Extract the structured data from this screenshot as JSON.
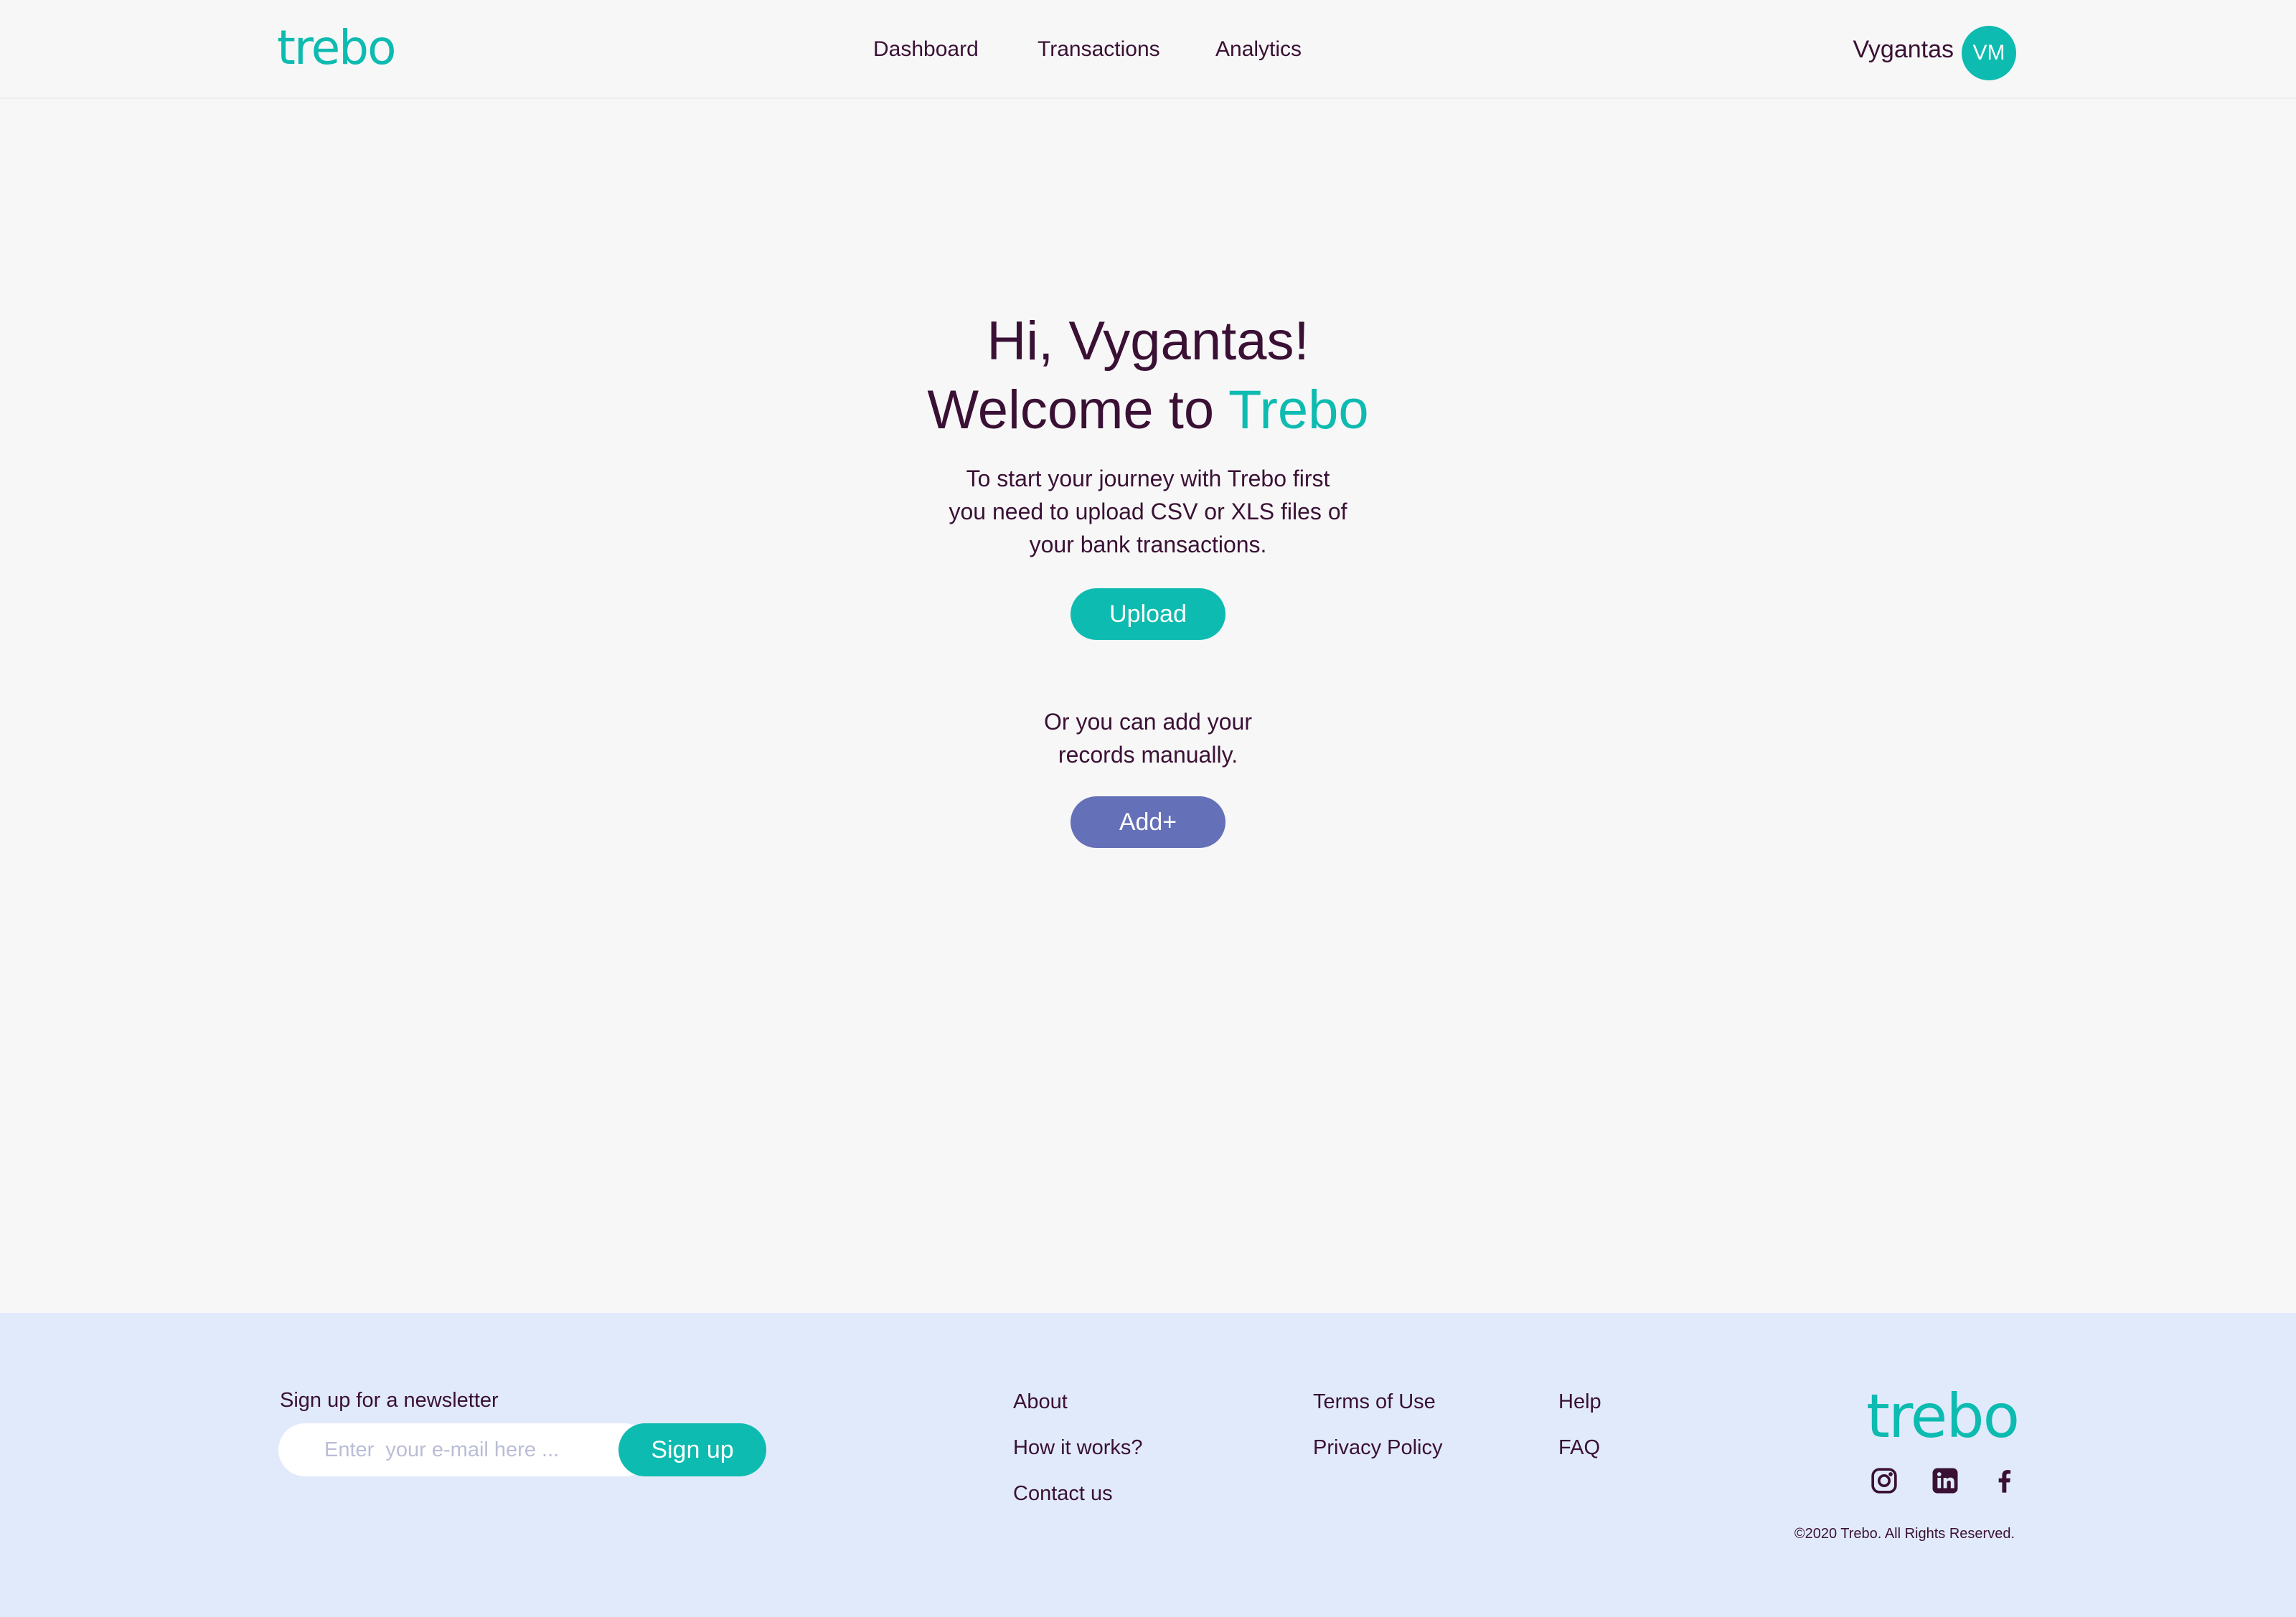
{
  "brand": {
    "logo_text": "trebo",
    "accent_color": "#0dbbb0",
    "secondary_color": "#6470b7",
    "text_color": "#3a1135"
  },
  "header": {
    "nav": [
      {
        "label": "Dashboard"
      },
      {
        "label": "Transactions"
      },
      {
        "label": "Analytics"
      }
    ],
    "user": {
      "name": "Vygantas",
      "initials": "VM"
    }
  },
  "main": {
    "greeting": "Hi, Vygantas!",
    "welcome_prefix": "Welcome to",
    "welcome_brand": "Trebo",
    "intro_lines": [
      "To start your journey with Trebo first",
      "you need to upload CSV or XLS files of",
      "your bank transactions."
    ],
    "upload_label": "Upload",
    "manual_lines": [
      "Or you can add your",
      "records manually."
    ],
    "add_label": "Add+"
  },
  "footer": {
    "newsletter_label": "Sign up for a newsletter",
    "email_placeholder": "Enter  your e-mail here ...",
    "signup_label": "Sign up",
    "links_col1": [
      "About",
      "How it works?",
      "Contact us"
    ],
    "links_col2": [
      "Terms of Use",
      "Privacy Policy"
    ],
    "links_col3": [
      "Help",
      "FAQ"
    ],
    "logo_text": "trebo",
    "social_icons": [
      "instagram-icon",
      "linkedin-icon",
      "facebook-icon"
    ],
    "copyright": "©2020 Trebo. All Rights Reserved."
  }
}
